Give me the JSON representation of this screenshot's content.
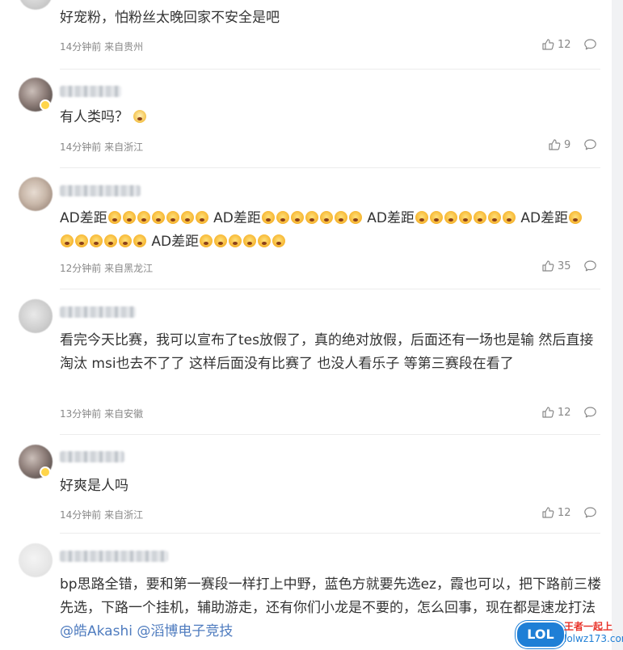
{
  "comments": [
    {
      "text": "好宠粉，怕粉丝太晚回家不安全是吧",
      "meta": "14分钟前 来自贵州",
      "likes": "12"
    },
    {
      "text": "有人类吗？",
      "meta": "14分钟前 来自浙江",
      "likes": "9"
    },
    {
      "segments": [
        "AD差距",
        "AD差距",
        "AD差距",
        "AD差距",
        "AD差距"
      ],
      "meta": "12分钟前 来自黑龙江",
      "likes": "35"
    },
    {
      "text": "看完今天比赛，我可以宣布了tes放假了，真的绝对放假，后面还有一场也是输 然后直接淘汰 msi也去不了了 这样后面没有比赛了 也没人看乐子 等第三赛段在看了",
      "meta": "13分钟前 来自安徽",
      "likes": "12"
    },
    {
      "text": "好爽是人吗",
      "meta": "14分钟前 来自浙江",
      "likes": "12"
    },
    {
      "text": "bp思路全错，要和第一赛段一样打上中野，蓝色方就要先选ez，霞也可以，把下路前三楼先选，下路一个挂机，辅助游走，还有你们小龙是不要的，怎么回事，现在都是速龙打法",
      "mention1": "@皓Akashi",
      "mention2": "@滔博电子竞技"
    }
  ],
  "watermark": {
    "badge": "LOL",
    "title": "王者一起上",
    "url": "lolwz173.com"
  },
  "icons": {
    "like": "thumbs-up-icon",
    "reply": "comment-bubble-icon"
  }
}
